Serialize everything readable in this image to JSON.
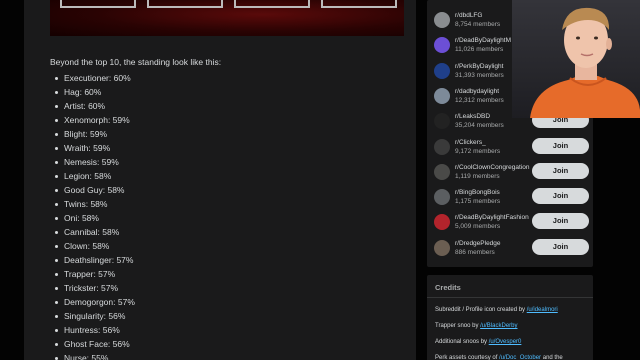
{
  "post": {
    "intro": "Beyond the top 10, the standing look like this:",
    "standings": [
      "Executioner: 60%",
      "Hag: 60%",
      "Artist: 60%",
      "Xenomorph: 59%",
      "Blight: 59%",
      "Wraith: 59%",
      "Nemesis: 59%",
      "Legion: 58%",
      "Good Guy: 58%",
      "Twins: 58%",
      "Oni: 58%",
      "Cannibal: 58%",
      "Clown: 58%",
      "Deathslinger: 57%",
      "Trapper: 57%",
      "Trickster: 57%",
      "Demogorgon: 57%",
      "Singularity: 56%",
      "Huntress: 56%",
      "Ghost Face: 56%",
      "Nurse: 55%"
    ]
  },
  "sidebar": {
    "join_label": "Join",
    "communities": [
      {
        "name": "r/dbdLFG",
        "members": "8,754 members",
        "color": "#8a8d90"
      },
      {
        "name": "r/DeadByDaylightM",
        "members": "11,026 members",
        "color": "#6c4fd6"
      },
      {
        "name": "r/PerkByDaylight",
        "members": "31,393 members",
        "color": "#1f3f8a"
      },
      {
        "name": "r/dadbydaylight",
        "members": "12,312 members",
        "color": "#7d8a99"
      },
      {
        "name": "r/LeaksDBD",
        "members": "35,204 members",
        "color": "#222222"
      },
      {
        "name": "r/Clickers_",
        "members": "9,172 members",
        "color": "#3a3a3a"
      },
      {
        "name": "r/CoolClownCongregation",
        "members": "1,119 members",
        "color": "#4a4a48"
      },
      {
        "name": "r/BingBongBois",
        "members": "1,175 members",
        "color": "#5b5e61"
      },
      {
        "name": "r/DeadByDaylightFashion",
        "members": "5,009 members",
        "color": "#b3242c"
      },
      {
        "name": "r/DredgePledge",
        "members": "886 members",
        "color": "#6b5e52"
      }
    ]
  },
  "credits": {
    "title": "Credits",
    "lines": [
      {
        "text": "Subreddit / Profile icon created by ",
        "link": "/u/idealmori"
      },
      {
        "text": "Trapper snoo by ",
        "link": "/u/BlackDerby"
      },
      {
        "text": "Additional snoos by ",
        "link": "/u/Ovesper0"
      },
      {
        "text": "Perk assets courtesy of ",
        "link": "/u/Doc_October",
        "suffix": " and the"
      }
    ]
  },
  "colors": {
    "background": "#030303",
    "card": "#1a1a1b",
    "link": "#4fbcff",
    "button": "#d7dadc"
  }
}
